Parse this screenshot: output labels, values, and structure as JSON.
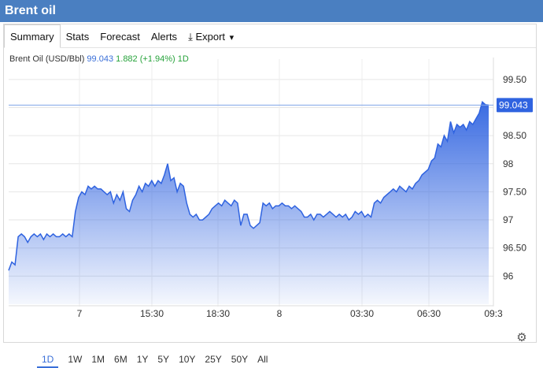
{
  "header": {
    "title": "Brent oil"
  },
  "tabs": [
    {
      "label": "Summary"
    },
    {
      "label": "Stats"
    },
    {
      "label": "Forecast"
    },
    {
      "label": "Alerts"
    },
    {
      "label": "Export"
    }
  ],
  "quote": {
    "name": "Brent Oil (USD/Bbl)",
    "price": "99.043",
    "change": "1.882",
    "percent": "(+1.94%)",
    "period": "1D"
  },
  "ranges": [
    {
      "label": "1D"
    },
    {
      "label": "1W"
    },
    {
      "label": "1M"
    },
    {
      "label": "6M"
    },
    {
      "label": "1Y"
    },
    {
      "label": "5Y"
    },
    {
      "label": "10Y"
    },
    {
      "label": "25Y"
    },
    {
      "label": "50Y"
    },
    {
      "label": "All"
    }
  ],
  "colors": {
    "header": "#4a7fc1",
    "line": "#2f63e0",
    "accent": "#3a6fd8",
    "up": "#27a33b"
  },
  "chart_data": {
    "type": "area",
    "title": "",
    "xlabel": "",
    "ylabel": "",
    "ylim": [
      95.5,
      99.75
    ],
    "x_ticks": [
      "7",
      "15:30",
      "18:30",
      "8",
      "03:30",
      "06:30",
      "09:3"
    ],
    "x_tick_positions": [
      0.14,
      0.29,
      0.43,
      0.57,
      0.72,
      0.86,
      1.0
    ],
    "y_ticks": [
      "96",
      "96.50",
      "97",
      "97.50",
      "98",
      "98.50",
      "99",
      "99.50"
    ],
    "y_tick_values": [
      96,
      96.5,
      97,
      97.5,
      98,
      98.5,
      99,
      99.5
    ],
    "last_price_label": "99.043",
    "last_price": 99.043,
    "grid": true,
    "values": [
      96.1,
      96.25,
      96.2,
      96.7,
      96.75,
      96.7,
      96.6,
      96.7,
      96.75,
      96.7,
      96.75,
      96.65,
      96.75,
      96.7,
      96.75,
      96.7,
      96.7,
      96.75,
      96.7,
      96.75,
      96.7,
      97.15,
      97.4,
      97.5,
      97.45,
      97.6,
      97.55,
      97.6,
      97.55,
      97.55,
      97.5,
      97.45,
      97.5,
      97.3,
      97.45,
      97.35,
      97.5,
      97.2,
      97.15,
      97.35,
      97.45,
      97.6,
      97.5,
      97.65,
      97.6,
      97.7,
      97.6,
      97.7,
      97.65,
      97.8,
      98.0,
      97.7,
      97.75,
      97.5,
      97.65,
      97.6,
      97.3,
      97.1,
      97.05,
      97.1,
      97.0,
      97.0,
      97.05,
      97.1,
      97.2,
      97.25,
      97.3,
      97.25,
      97.35,
      97.3,
      97.25,
      97.35,
      97.3,
      96.9,
      97.1,
      97.1,
      96.9,
      96.85,
      96.9,
      96.95,
      97.3,
      97.25,
      97.3,
      97.2,
      97.25,
      97.25,
      97.3,
      97.25,
      97.25,
      97.2,
      97.25,
      97.2,
      97.15,
      97.05,
      97.05,
      97.1,
      97.0,
      97.1,
      97.1,
      97.05,
      97.1,
      97.15,
      97.1,
      97.05,
      97.1,
      97.05,
      97.1,
      97.0,
      97.05,
      97.15,
      97.1,
      97.15,
      97.05,
      97.1,
      97.05,
      97.3,
      97.35,
      97.3,
      97.4,
      97.45,
      97.5,
      97.55,
      97.5,
      97.6,
      97.55,
      97.5,
      97.6,
      97.55,
      97.65,
      97.7,
      97.8,
      97.85,
      97.9,
      98.05,
      98.1,
      98.35,
      98.3,
      98.5,
      98.4,
      98.75,
      98.55,
      98.7,
      98.65,
      98.7,
      98.6,
      98.75,
      98.7,
      98.8,
      98.9,
      99.1,
      99.05,
      99.043
    ]
  }
}
